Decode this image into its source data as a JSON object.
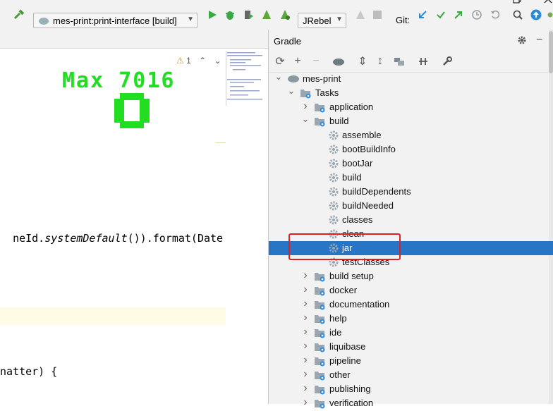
{
  "toolbar": {
    "run_config": "mes-print:print-interface [build]",
    "jrebel": "JRebel",
    "git_label": "Git:"
  },
  "editor": {
    "warning_count": "1",
    "max_text": "Max 7016",
    "code_line_1_pre": "neId.",
    "code_line_1_italic": "systemDefault",
    "code_line_1_post": "()).format(Date",
    "code_line_2": "natter) {"
  },
  "gradle": {
    "title": "Gradle",
    "tree": [
      {
        "label": "mes-print",
        "level": 0,
        "expanded": true,
        "type": "project"
      },
      {
        "label": "Tasks",
        "level": 1,
        "expanded": true,
        "type": "folder"
      },
      {
        "label": "application",
        "level": 2,
        "expanded": false,
        "type": "folder"
      },
      {
        "label": "build",
        "level": 2,
        "expanded": true,
        "type": "folder"
      },
      {
        "label": "assemble",
        "level": 3,
        "type": "task"
      },
      {
        "label": "bootBuildInfo",
        "level": 3,
        "type": "task"
      },
      {
        "label": "bootJar",
        "level": 3,
        "type": "task"
      },
      {
        "label": "build",
        "level": 3,
        "type": "task"
      },
      {
        "label": "buildDependents",
        "level": 3,
        "type": "task"
      },
      {
        "label": "buildNeeded",
        "level": 3,
        "type": "task"
      },
      {
        "label": "classes",
        "level": 3,
        "type": "task"
      },
      {
        "label": "clean",
        "level": 3,
        "type": "task"
      },
      {
        "label": "jar",
        "level": 3,
        "type": "task",
        "selected": true
      },
      {
        "label": "testClasses",
        "level": 3,
        "type": "task"
      },
      {
        "label": "build setup",
        "level": 2,
        "expanded": false,
        "type": "folder"
      },
      {
        "label": "docker",
        "level": 2,
        "expanded": false,
        "type": "folder"
      },
      {
        "label": "documentation",
        "level": 2,
        "expanded": false,
        "type": "folder"
      },
      {
        "label": "help",
        "level": 2,
        "expanded": false,
        "type": "folder"
      },
      {
        "label": "ide",
        "level": 2,
        "expanded": false,
        "type": "folder"
      },
      {
        "label": "liquibase",
        "level": 2,
        "expanded": false,
        "type": "folder"
      },
      {
        "label": "pipeline",
        "level": 2,
        "expanded": false,
        "type": "folder"
      },
      {
        "label": "other",
        "level": 2,
        "expanded": false,
        "type": "folder"
      },
      {
        "label": "publishing",
        "level": 2,
        "expanded": false,
        "type": "folder"
      },
      {
        "label": "verification",
        "level": 2,
        "expanded": false,
        "type": "folder"
      }
    ]
  },
  "colors": {
    "selection": "#2775c4",
    "highlight_box": "#e02020",
    "green_text": "#22dd22"
  }
}
